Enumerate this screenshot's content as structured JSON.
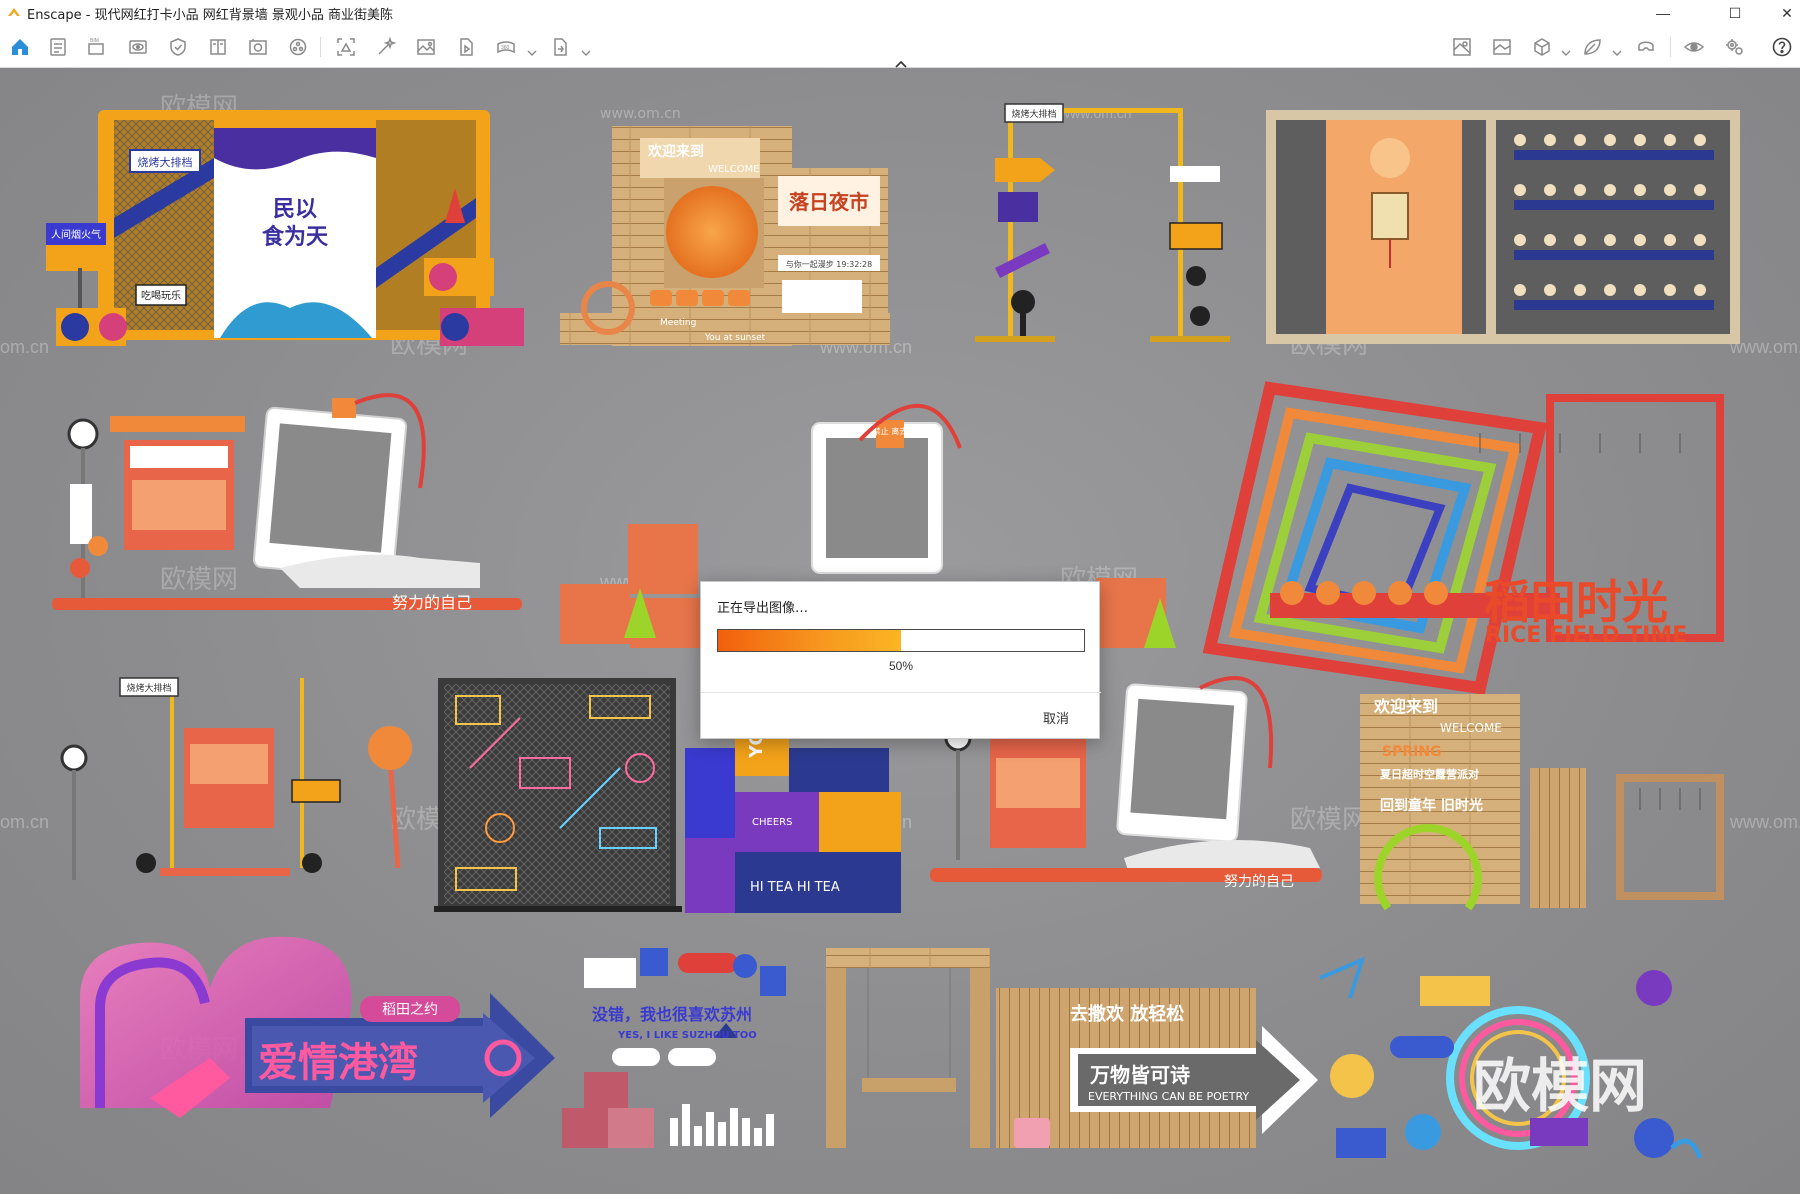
{
  "window": {
    "app_name": "Enscape",
    "separator": " - ",
    "document_title": "现代网红打卡小品 网红背景墙 景观小品 商业街美陈",
    "controls": {
      "minimize": "—",
      "maximize": "☐",
      "close": "✕"
    }
  },
  "toolbar": {
    "left_icons": [
      "home-icon",
      "document-icon",
      "bim-icon",
      "eye-frame-icon",
      "shield-icon",
      "book-icon",
      "library-icon",
      "settings-circle-icon",
      "capture-icon",
      "magic-wand-icon",
      "image-icon",
      "video-icon",
      "panorama-360-icon",
      "export-icon"
    ],
    "bim_label": "BIM",
    "right_icons": [
      "map-icon",
      "image-frame-icon",
      "cube-icon",
      "leaf-icon",
      "vr-headset-icon",
      "eye-icon",
      "gears-icon",
      "help-icon"
    ]
  },
  "viewport": {
    "watermark_small": "www.om.cn",
    "watermark_om": "om.cn",
    "watermark_large": "欧模网",
    "watermark_big_logo": "欧模网",
    "scene_texts": {
      "grill": "烧烤大排档",
      "fireworks": "人间烟火气",
      "food_title_1": "民以",
      "food_title_2": "食为天",
      "fry": "吃喝玩乐",
      "sunset_welcome": "欢迎来到",
      "sunset_welcome_en": "WELCOME",
      "sunset_title": "落日夜市",
      "sunset_time": "与你一起漫步 19:32:28",
      "meeting": "Meeting",
      "at_sunset": "You at sunset",
      "rice_field_time": "稻田时光",
      "rice_field_time_en": "RICE FIELD TIME",
      "no_leave": "禁止 离去",
      "effort": "努力的自己",
      "youth": "YOUTH",
      "hi_tea": "HI TEA HI TEA",
      "cheers": "CHEERS",
      "spring_welcome": "欢迎来到",
      "spring_welcome_en": "WELCOME",
      "spring": "SPRING",
      "summer_party": "夏日超时空露营派对",
      "childhood": "回到童年 旧时光",
      "love_harbor": "爱情港湾",
      "rice_promise": "稻田之约",
      "suzhou": "没错，我也很喜欢苏州",
      "suzhou_en": "YES, I LIKE SUZHOU TOO",
      "poetry": "万物皆可诗",
      "poetry_en": "EVERYTHING CAN BE POETRY",
      "relax": "去撒欢 放轻松"
    }
  },
  "dialog": {
    "message": "正在导出图像…",
    "progress": 0.5,
    "percent_label": "50%",
    "cancel_label": "取消",
    "progress_colors": [
      "#f1600c",
      "#f7961f",
      "#fbb523"
    ]
  }
}
